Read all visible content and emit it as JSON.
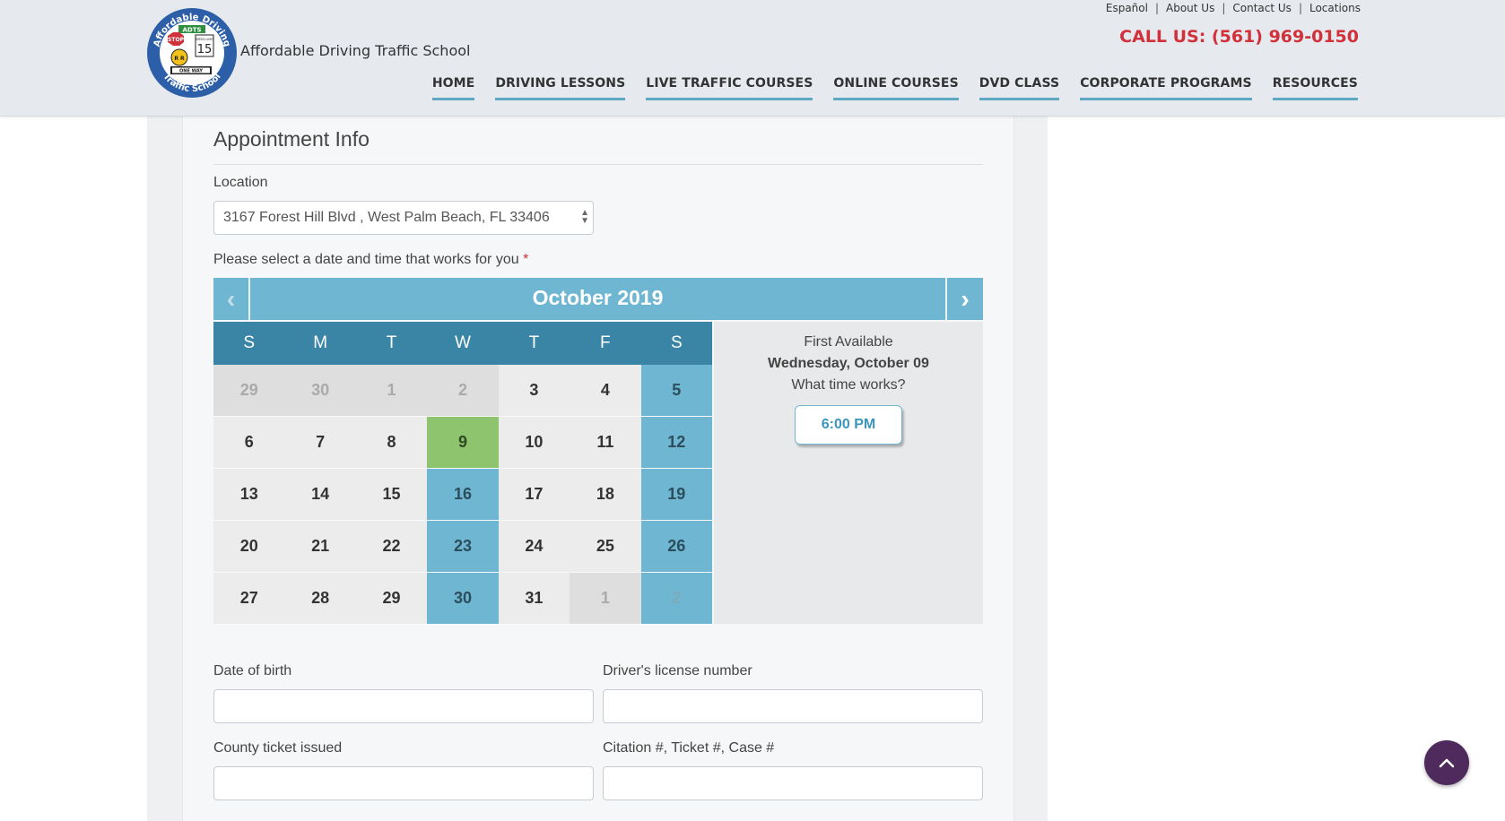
{
  "header": {
    "brand_name": "Affordable Driving Traffic School",
    "logo_text": {
      "ring_top": "Affordable Driving",
      "ring_bottom": "Traffic School",
      "center_top": "ADTS",
      "stop": "STOP",
      "speed": "SPEED LIMIT",
      "speed_value": "15",
      "rr": "R R",
      "one_way": "ONE WAY"
    },
    "top_links": [
      "Español",
      "About Us",
      "Contact Us",
      "Locations"
    ],
    "call_us": "CALL US: (561) 969-0150",
    "nav": [
      "HOME",
      "DRIVING LESSONS",
      "LIVE TRAFFIC COURSES",
      "ONLINE COURSES",
      "DVD CLASS",
      "CORPORATE PROGRAMS",
      "RESOURCES"
    ]
  },
  "form": {
    "section_title": "Appointment Info",
    "location_label": "Location",
    "location_value": "3167 Forest Hill Blvd , West Palm Beach, FL 33406",
    "date_prompt": "Please select a date and time that works for you",
    "required_mark": "*",
    "dob_label": "Date of birth",
    "license_label": "Driver's license number",
    "county_label": "County ticket issued",
    "citation_label": "Citation #, Ticket #, Case #"
  },
  "calendar": {
    "month": "October 2019",
    "prev_icon": "‹",
    "next_icon": "›",
    "weekdays": [
      "S",
      "M",
      "T",
      "W",
      "T",
      "F",
      "S"
    ],
    "weeks": [
      [
        {
          "d": "29",
          "s": "muted"
        },
        {
          "d": "30",
          "s": "muted"
        },
        {
          "d": "1",
          "s": "muted"
        },
        {
          "d": "2",
          "s": "muted"
        },
        {
          "d": "3",
          "s": ""
        },
        {
          "d": "4",
          "s": ""
        },
        {
          "d": "5",
          "s": "avail"
        }
      ],
      [
        {
          "d": "6",
          "s": ""
        },
        {
          "d": "7",
          "s": ""
        },
        {
          "d": "8",
          "s": ""
        },
        {
          "d": "9",
          "s": "selected"
        },
        {
          "d": "10",
          "s": ""
        },
        {
          "d": "11",
          "s": ""
        },
        {
          "d": "12",
          "s": "avail"
        }
      ],
      [
        {
          "d": "13",
          "s": ""
        },
        {
          "d": "14",
          "s": ""
        },
        {
          "d": "15",
          "s": ""
        },
        {
          "d": "16",
          "s": "avail"
        },
        {
          "d": "17",
          "s": ""
        },
        {
          "d": "18",
          "s": ""
        },
        {
          "d": "19",
          "s": "avail"
        }
      ],
      [
        {
          "d": "20",
          "s": ""
        },
        {
          "d": "21",
          "s": ""
        },
        {
          "d": "22",
          "s": ""
        },
        {
          "d": "23",
          "s": "avail"
        },
        {
          "d": "24",
          "s": ""
        },
        {
          "d": "25",
          "s": ""
        },
        {
          "d": "26",
          "s": "avail"
        }
      ],
      [
        {
          "d": "27",
          "s": ""
        },
        {
          "d": "28",
          "s": ""
        },
        {
          "d": "29",
          "s": ""
        },
        {
          "d": "30",
          "s": "avail"
        },
        {
          "d": "31",
          "s": ""
        },
        {
          "d": "1",
          "s": "muted"
        },
        {
          "d": "2",
          "s": "avail muted"
        }
      ]
    ],
    "first_available_label": "First Available",
    "first_available_date": "Wednesday, October 09",
    "time_prompt": "What time works?",
    "time_slot": "6:00 PM"
  },
  "colors": {
    "accent": "#6fb6d2",
    "weekday_bar": "#3a85a6",
    "selected_day": "#8fc46f",
    "call_red": "#d0313a",
    "scroll_top_button": "#4f2a5c"
  },
  "scroll_top_icon": "chevron-up-icon"
}
